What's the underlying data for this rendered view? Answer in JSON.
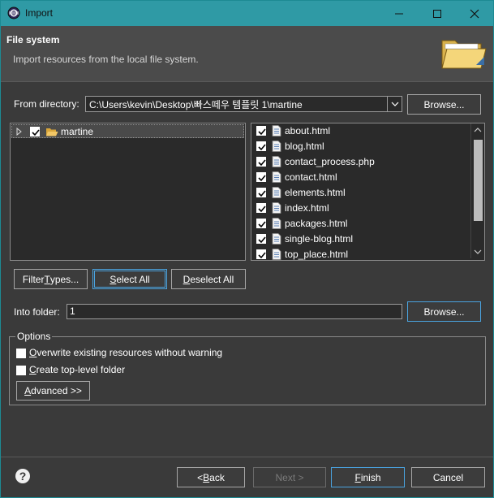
{
  "window": {
    "title": "Import"
  },
  "banner": {
    "heading": "File system",
    "description": "Import resources from the local file system."
  },
  "from_directory": {
    "label": "From directory:",
    "value": "C:\\Users\\kevin\\Desktop\\빠스떼우 템플릿 1\\martine",
    "browse_label": "Browse..."
  },
  "tree": {
    "items": [
      {
        "label": "martine",
        "checked": true
      }
    ]
  },
  "files": [
    {
      "name": "about.html",
      "checked": true
    },
    {
      "name": "blog.html",
      "checked": true
    },
    {
      "name": "contact_process.php",
      "checked": true
    },
    {
      "name": "contact.html",
      "checked": true
    },
    {
      "name": "elements.html",
      "checked": true
    },
    {
      "name": "index.html",
      "checked": true
    },
    {
      "name": "packages.html",
      "checked": true
    },
    {
      "name": "single-blog.html",
      "checked": true
    },
    {
      "name": "top_place.html",
      "checked": true
    }
  ],
  "buttons": {
    "filter_types": {
      "pre": "Filter ",
      "u": "T",
      "post": "ypes..."
    },
    "select_all": {
      "u": "S",
      "post": "elect All"
    },
    "deselect_all": {
      "u": "D",
      "post": "eselect All"
    }
  },
  "into_folder": {
    "label": "Into folder:",
    "value": "1",
    "browse_label": "Browse..."
  },
  "options": {
    "legend": "Options",
    "overwrite": {
      "u": "O",
      "post": "verwrite existing resources without warning"
    },
    "create_top": {
      "u": "C",
      "post": "reate top-level folder"
    },
    "advanced": {
      "u": "A",
      "post": "dvanced >>"
    }
  },
  "footer": {
    "back": {
      "pre": "< ",
      "u": "B",
      "post": "ack"
    },
    "next": "Next >",
    "finish": {
      "u": "F",
      "post": "inish"
    },
    "cancel": "Cancel"
  },
  "colors": {
    "title_bar": "#2f9aa5",
    "dialog_bg": "#3a3a3a",
    "focus": "#4aa3df"
  }
}
